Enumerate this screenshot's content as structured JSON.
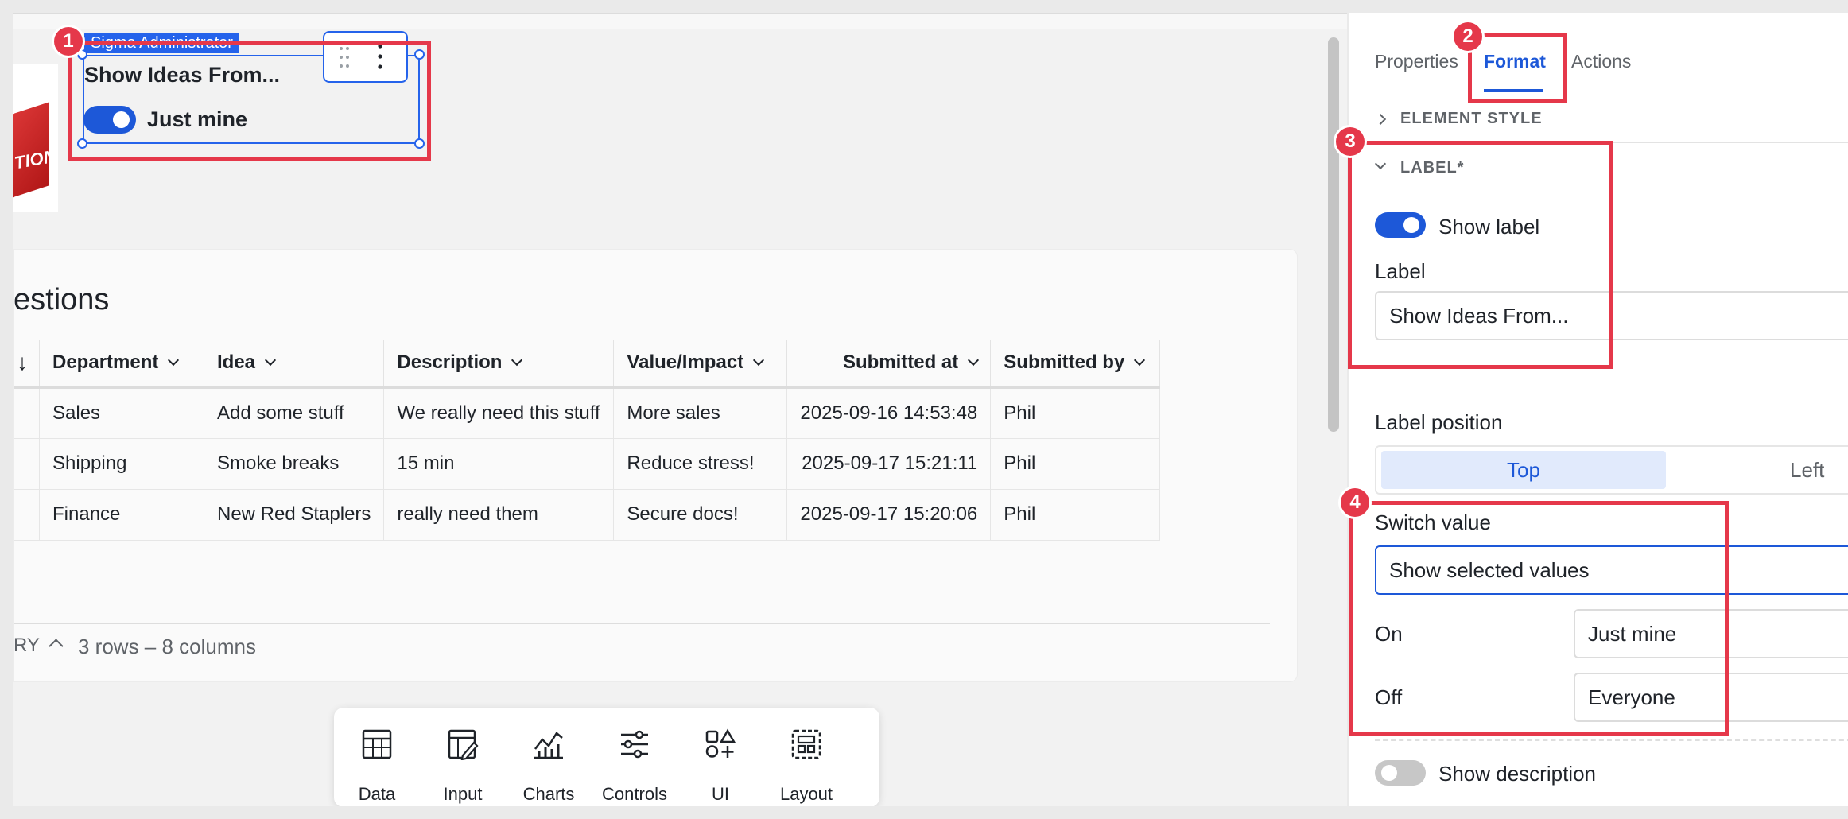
{
  "canvas": {
    "control": {
      "owner_badge": "Sigma Administrator",
      "label": "Show Ideas From...",
      "value_text": "Just mine"
    },
    "table": {
      "title_partial": "estions",
      "columns": [
        "Department",
        "Idea",
        "Description",
        "Value/Impact",
        "Submitted at",
        "Submitted by"
      ],
      "rows": [
        [
          "Sales",
          "Add some stuff",
          "We really need this stuff",
          "More sales",
          "2025-09-16 14:53:48",
          "Phil"
        ],
        [
          "Shipping",
          "Smoke breaks",
          "15 min",
          "Reduce stress!",
          "2025-09-17 15:21:11",
          "Phil"
        ],
        [
          "Finance",
          "New Red Staplers",
          "really need them",
          "Secure docs!",
          "2025-09-17 15:20:06",
          "Phil"
        ]
      ],
      "summary_label_partial": "RY",
      "summary_count": "3 rows – 8 columns"
    },
    "thumbnail_text": "TION",
    "toolbar": [
      {
        "label": "Data",
        "icon": "table-icon"
      },
      {
        "label": "Input",
        "icon": "input-table-icon"
      },
      {
        "label": "Charts",
        "icon": "chart-icon"
      },
      {
        "label": "Controls",
        "icon": "sliders-icon"
      },
      {
        "label": "UI",
        "icon": "shapes-icon"
      },
      {
        "label": "Layout",
        "icon": "layout-icon"
      }
    ]
  },
  "panel": {
    "tabs": [
      "Properties",
      "Format",
      "Actions"
    ],
    "active_tab": "Format",
    "element_style": "ELEMENT STYLE",
    "label_section": "LABEL*",
    "show_label": "Show label",
    "label_field_label": "Label",
    "label_value": "Show Ideas From...",
    "label_position_label": "Label position",
    "label_position_options": [
      "Top",
      "Left"
    ],
    "label_position_selected": "Top",
    "switch_value_label": "Switch value",
    "switch_value": "Show selected values",
    "on_label": "On",
    "on_value": "Just mine",
    "off_label": "Off",
    "off_value": "Everyone",
    "show_description": "Show description"
  },
  "annotations": [
    "1",
    "2",
    "3",
    "4"
  ],
  "colors": {
    "accent": "#1d58d8",
    "annotation": "#e5384a",
    "selection": "#2563eb"
  }
}
